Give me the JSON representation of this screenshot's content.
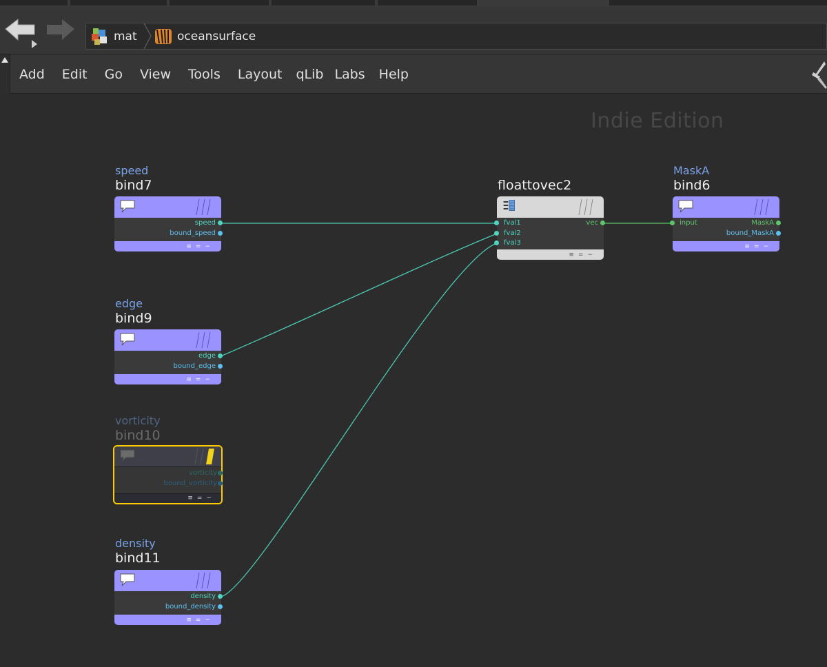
{
  "pathbar": {
    "crumbs": [
      {
        "label": "mat",
        "icon": "material-network-icon"
      },
      {
        "label": "oceansurface",
        "icon": "shader-tiger-icon"
      }
    ]
  },
  "menubar": {
    "items": [
      "Add",
      "Edit",
      "Go",
      "View",
      "Tools",
      "Layout",
      "qLib",
      "Labs",
      "Help"
    ]
  },
  "canvas": {
    "watermark": "Indie Edition"
  },
  "colors": {
    "bind_node": "#9a93ff",
    "wire": "#4cc9b0",
    "port_float": "#4ed4c0",
    "port_bound": "#5bc0f0",
    "selected_outline": "#ffcc00"
  },
  "nodes": {
    "speed": {
      "label": "speed",
      "name": "bind7",
      "ports": [
        "speed",
        "bound_speed"
      ]
    },
    "edge": {
      "label": "edge",
      "name": "bind9",
      "ports": [
        "edge",
        "bound_edge"
      ]
    },
    "vorticity": {
      "label": "vorticity",
      "name": "bind10",
      "ports": [
        "vorticity",
        "bound_vorticity"
      ]
    },
    "density": {
      "label": "density",
      "name": "bind11",
      "ports": [
        "density",
        "bound_density"
      ]
    },
    "floattovec": {
      "label": "",
      "name": "floattovec2",
      "inputs": [
        "fval1",
        "fval2",
        "fval3"
      ],
      "output": "vec"
    },
    "maska": {
      "label": "MaskA",
      "name": "bind6",
      "input": "input",
      "ports": [
        "MaskA",
        "bound_MaskA"
      ]
    }
  }
}
